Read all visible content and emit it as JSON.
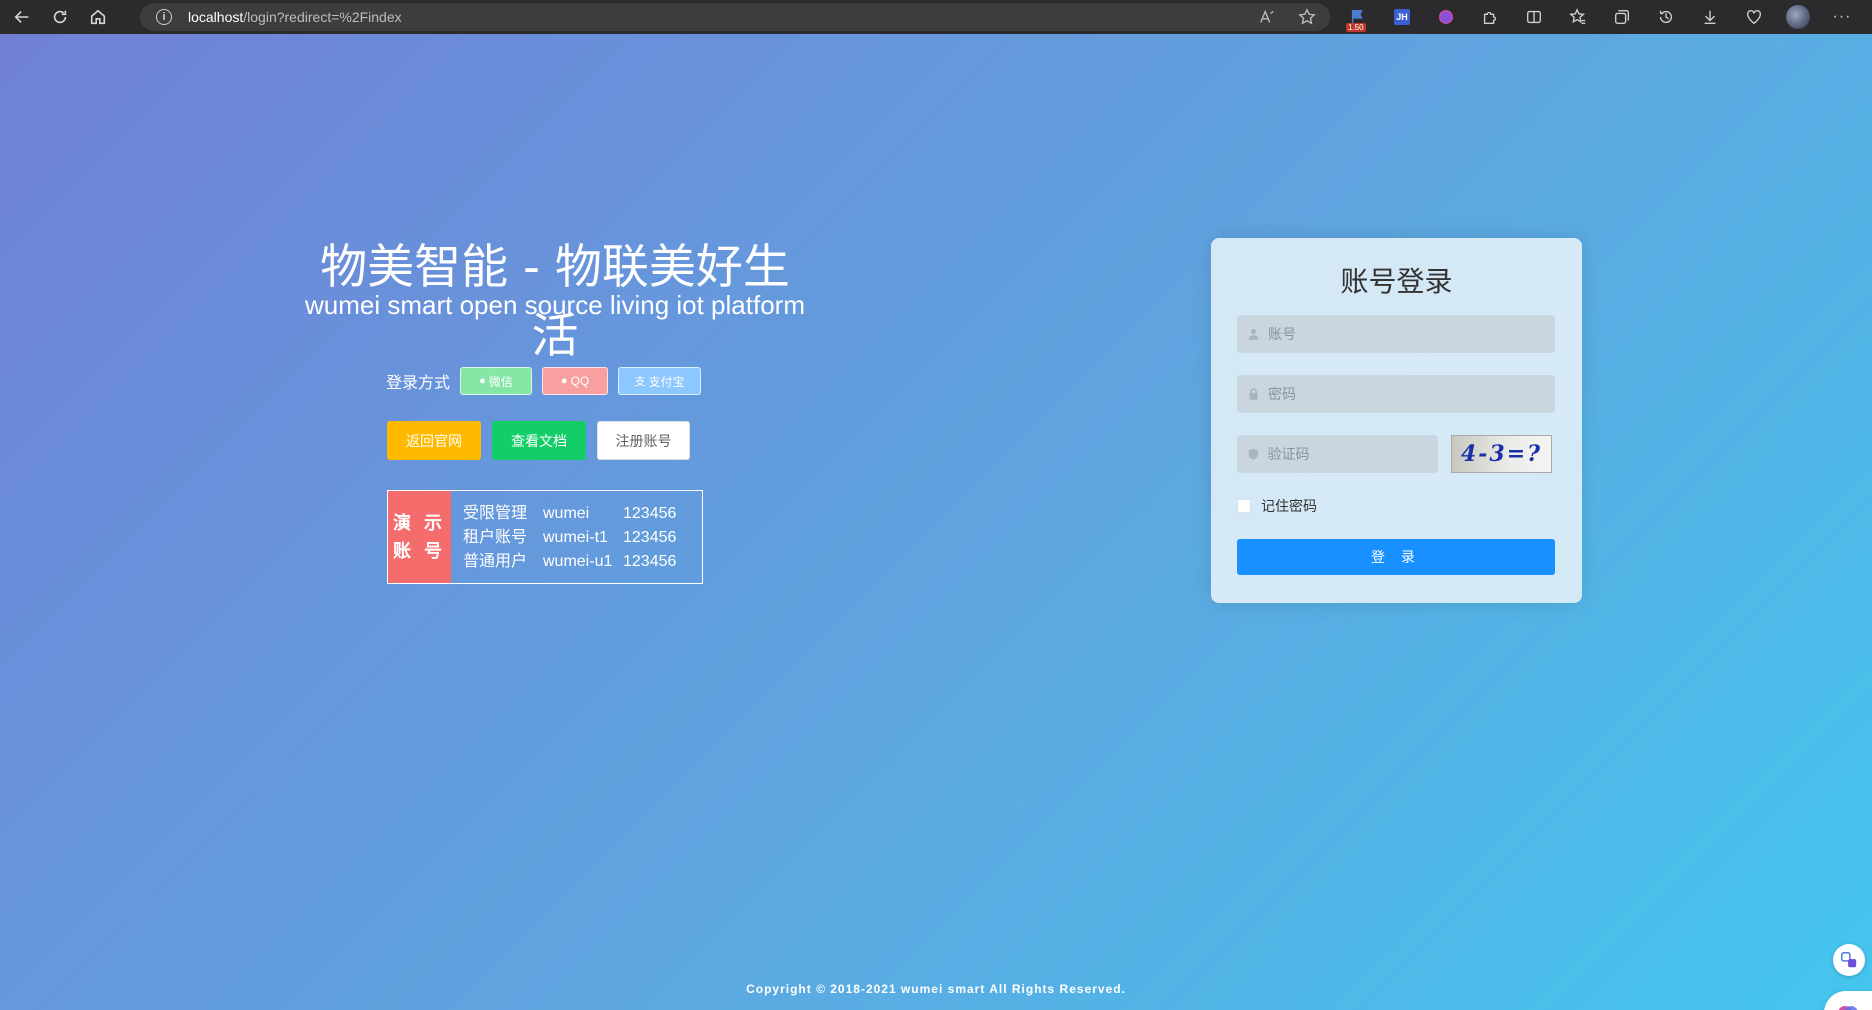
{
  "browser": {
    "url_host": "localhost",
    "url_path": "/login?redirect=%2Findex",
    "ext_badge": "1.50",
    "ext_jh": "JH"
  },
  "hero": {
    "title": "物美智能 - 物联美好生活",
    "subtitle": "wumei smart open source living iot platform"
  },
  "login_methods": {
    "label": "登录方式",
    "wechat": "微信",
    "qq": "QQ",
    "alipay": "支付宝"
  },
  "links": {
    "home": "返回官网",
    "docs": "查看文档",
    "register": "注册账号"
  },
  "demo": {
    "tag_line1": "演 示",
    "tag_line2": "账 号",
    "rows": [
      {
        "role": "受限管理",
        "user": "wumei",
        "pass": "123456"
      },
      {
        "role": "租户账号",
        "user": "wumei-t1",
        "pass": "123456"
      },
      {
        "role": "普通用户",
        "user": "wumei-u1",
        "pass": "123456"
      }
    ]
  },
  "login_form": {
    "title": "账号登录",
    "username_placeholder": "账号",
    "password_placeholder": "密码",
    "code_placeholder": "验证码",
    "captcha_text": "4-3=?",
    "remember_label": "记住密码",
    "submit_label": "登 录"
  },
  "footer": {
    "copyright": "Copyright © 2018-2021 wumei smart All Rights Reserved."
  },
  "colors": {
    "primary": "#1890ff",
    "warning": "#ffba00",
    "success": "#13ce66",
    "danger": "#f56c6c"
  }
}
